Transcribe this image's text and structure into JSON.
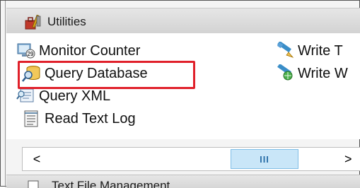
{
  "group": {
    "title": "Utilities",
    "icon": "utilities-toolbox-icon"
  },
  "items": [
    {
      "label": "Monitor Counter",
      "icon": "monitor-counter-icon"
    },
    {
      "label": "Query Database",
      "icon": "query-database-icon"
    },
    {
      "label": "Query XML",
      "icon": "query-xml-icon"
    },
    {
      "label": "Read Text Log",
      "icon": "read-text-log-icon"
    },
    {
      "label": "Write T",
      "icon": "write-pencil-icon"
    },
    {
      "label": "Write W",
      "icon": "write-web-icon"
    }
  ],
  "highlight_color": "#e0202a",
  "scrollbar": {
    "left_arrow": "<",
    "right_arrow": ">",
    "thumb_grip": "III"
  },
  "next_group": {
    "title": "Text File Management"
  }
}
